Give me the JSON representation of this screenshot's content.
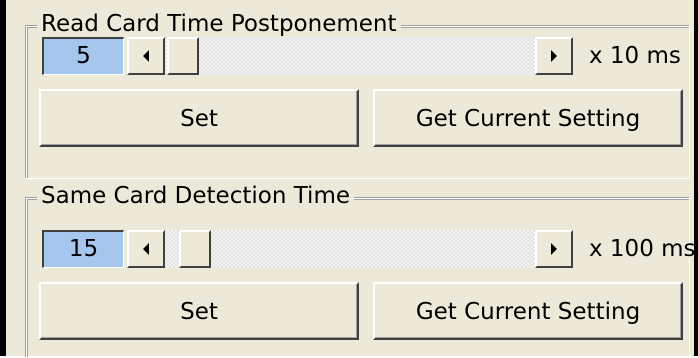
{
  "groups": [
    {
      "title": "Read Card Time Postponement",
      "value": "5",
      "unit": "x 10 ms",
      "set_label": "Set",
      "get_label": "Get Current Setting"
    },
    {
      "title": "Same Card Detection Time",
      "value": "15",
      "unit": "x 100 ms",
      "set_label": "Set",
      "get_label": "Get Current Setting"
    }
  ],
  "icons": {
    "scroll_left": "left-arrow-icon",
    "scroll_right": "right-arrow-icon"
  },
  "colors": {
    "value_highlight": "#a5c7ee",
    "window_bg": "#ece9d8"
  }
}
